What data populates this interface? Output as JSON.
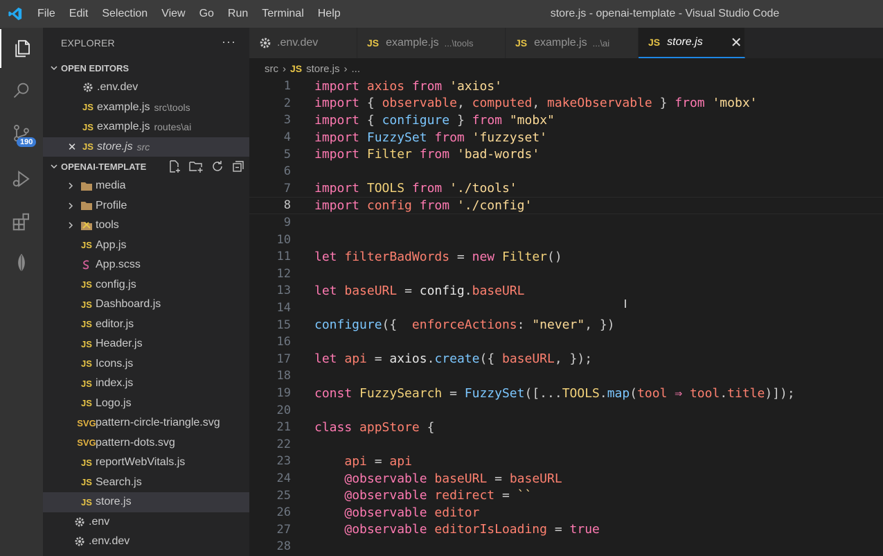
{
  "menu": [
    "File",
    "Edit",
    "Selection",
    "View",
    "Go",
    "Run",
    "Terminal",
    "Help"
  ],
  "window_title": "store.js - openai-template - Visual Studio Code",
  "activity": {
    "scm_badge": "190"
  },
  "explorer": {
    "title": "EXPLORER",
    "more": "···",
    "open_editors_label": "OPEN EDITORS",
    "open_editors": [
      {
        "name": ".env.dev",
        "desc": "",
        "type": "gear"
      },
      {
        "name": "example.js",
        "desc": "src\\tools",
        "type": "js"
      },
      {
        "name": "example.js",
        "desc": "routes\\ai",
        "type": "js"
      },
      {
        "name": "store.js",
        "desc": "src",
        "type": "js"
      }
    ],
    "project_label": "OPENAI-TEMPLATE",
    "tree": [
      {
        "name": "media",
        "type": "folder"
      },
      {
        "name": "Profile",
        "type": "folder"
      },
      {
        "name": "tools",
        "type": "tools-folder"
      },
      {
        "name": "App.js",
        "type": "js"
      },
      {
        "name": "App.scss",
        "type": "scss"
      },
      {
        "name": "config.js",
        "type": "js"
      },
      {
        "name": "Dashboard.js",
        "type": "js"
      },
      {
        "name": "editor.js",
        "type": "js"
      },
      {
        "name": "Header.js",
        "type": "js"
      },
      {
        "name": "Icons.js",
        "type": "js"
      },
      {
        "name": "index.js",
        "type": "js"
      },
      {
        "name": "Logo.js",
        "type": "js"
      },
      {
        "name": "pattern-circle-triangle.svg",
        "type": "svg"
      },
      {
        "name": "pattern-dots.svg",
        "type": "svg"
      },
      {
        "name": "reportWebVitals.js",
        "type": "js"
      },
      {
        "name": "Search.js",
        "type": "js"
      },
      {
        "name": "store.js",
        "type": "js"
      }
    ],
    "root_files": [
      {
        "name": ".env",
        "type": "gear"
      },
      {
        "name": ".env.dev",
        "type": "gear"
      }
    ]
  },
  "tabs": [
    {
      "label": ".env.dev",
      "desc": "",
      "type": "gear"
    },
    {
      "label": "example.js",
      "desc": "...\\tools",
      "type": "js"
    },
    {
      "label": "example.js",
      "desc": "...\\ai",
      "type": "js"
    },
    {
      "label": "store.js",
      "desc": "",
      "type": "js",
      "close": "✕"
    }
  ],
  "breadcrumb": {
    "folder": "src",
    "file": "store.js",
    "tail": "..."
  },
  "js_badge": "JS",
  "svg_badge": "SVG",
  "current_line": 8,
  "code_lines": [
    "import axios from 'axios'",
    "import { observable, computed, makeObservable } from 'mobx'",
    "import { configure } from \"mobx\"",
    "import FuzzySet from 'fuzzyset'",
    "import Filter from 'bad-words'",
    "",
    "import TOOLS from './tools'",
    "import config from './config'",
    "",
    "",
    "let filterBadWords = new Filter()",
    "",
    "let baseURL = config.baseURL",
    "",
    "configure({  enforceActions: \"never\", })",
    "",
    "let api = axios.create({ baseURL, });",
    "",
    "const FuzzySearch = FuzzySet([...TOOLS.map(tool ⇒ tool.title)]);",
    "",
    "class appStore {",
    "",
    "    api = api",
    "    @observable baseURL = baseURL",
    "    @observable redirect = ``",
    "    @observable editor",
    "    @observable editorIsLoading = true",
    ""
  ]
}
